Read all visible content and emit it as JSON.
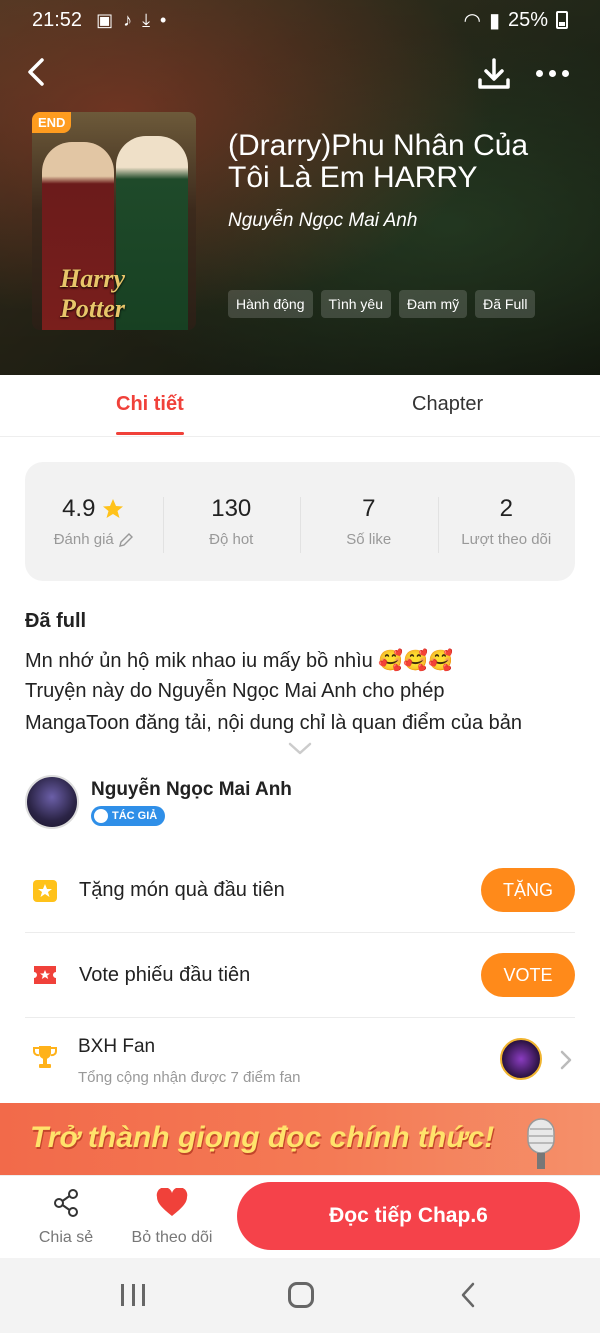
{
  "status_bar": {
    "time": "21:52",
    "battery": "25%"
  },
  "book": {
    "title": "(Drarry)Phu Nhân Của Tôi Là Em HARRY",
    "author": "Nguyễn Ngọc Mai Anh",
    "badge": "END",
    "cover_text": "Harry Potter",
    "tags": [
      "Hành động",
      "Tình yêu",
      "Đam mỹ",
      "Đã Full"
    ]
  },
  "tabs": {
    "detail": "Chi tiết",
    "chapter": "Chapter"
  },
  "stats": [
    {
      "value": "4.9",
      "label": "Đánh giá"
    },
    {
      "value": "130",
      "label": "Độ hot"
    },
    {
      "value": "7",
      "label": "Số like"
    },
    {
      "value": "2",
      "label": "Lượt theo dõi"
    }
  ],
  "description": {
    "heading": "Đã full",
    "lines": [
      "Mn nhớ ủn hộ mik nhao iu mấy bồ nhìu 🥰🥰🥰",
      "Truyện này do Nguyễn Ngọc Mai Anh cho phép",
      "MangaToon đăng tải, nội dung chỉ là quan điểm của bản"
    ]
  },
  "author_section": {
    "name": "Nguyễn Ngọc Mai Anh",
    "badge": "TÁC GIẢ"
  },
  "actions": {
    "gift_label": "Tặng món quà đầu tiên",
    "gift_button": "TẶNG",
    "vote_label": "Vote phiếu đầu tiên",
    "vote_button": "VOTE",
    "fan_title": "BXH Fan",
    "fan_subtitle": "Tổng cộng nhận được 7 điểm fan"
  },
  "banner": {
    "text": "Trở thành giọng đọc chính thức!"
  },
  "bottom_bar": {
    "share": "Chia sẻ",
    "unfollow": "Bỏ theo dõi",
    "read": "Đọc tiếp Chap.6"
  },
  "colors": {
    "accent": "#f0413a",
    "orange": "#ff8a1a",
    "read_button": "#f5424a"
  }
}
